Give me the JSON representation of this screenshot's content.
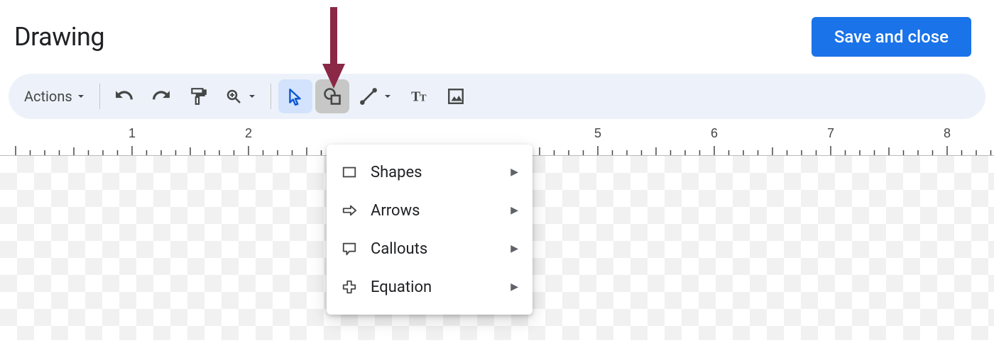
{
  "header": {
    "title": "Drawing",
    "save_button": "Save and close"
  },
  "toolbar": {
    "actions_label": "Actions",
    "items": {
      "undo": "undo",
      "redo": "redo",
      "paint_format": "paint-format",
      "zoom": "zoom",
      "select": "select",
      "shape": "shape",
      "line": "line",
      "text_box": "text-box",
      "image": "image"
    }
  },
  "ruler": {
    "labels": [
      "1",
      "2",
      "5",
      "6",
      "7",
      "8"
    ]
  },
  "shape_menu": {
    "items": [
      {
        "icon": "rectangle",
        "label": "Shapes"
      },
      {
        "icon": "arrow-right",
        "label": "Arrows"
      },
      {
        "icon": "callout",
        "label": "Callouts"
      },
      {
        "icon": "plus",
        "label": "Equation"
      }
    ]
  },
  "annotation": {
    "color": "#8a2846"
  }
}
